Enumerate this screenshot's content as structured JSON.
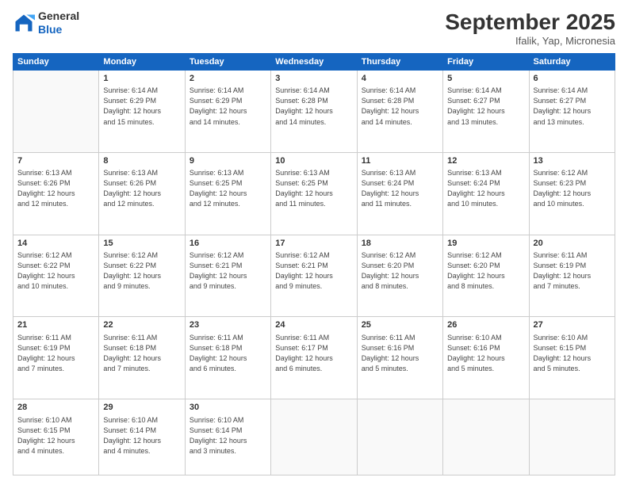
{
  "logo": {
    "general": "General",
    "blue": "Blue"
  },
  "title": "September 2025",
  "location": "Ifalik, Yap, Micronesia",
  "days_header": [
    "Sunday",
    "Monday",
    "Tuesday",
    "Wednesday",
    "Thursday",
    "Friday",
    "Saturday"
  ],
  "weeks": [
    [
      {
        "num": "",
        "info": ""
      },
      {
        "num": "1",
        "info": "Sunrise: 6:14 AM\nSunset: 6:29 PM\nDaylight: 12 hours\nand 15 minutes."
      },
      {
        "num": "2",
        "info": "Sunrise: 6:14 AM\nSunset: 6:29 PM\nDaylight: 12 hours\nand 14 minutes."
      },
      {
        "num": "3",
        "info": "Sunrise: 6:14 AM\nSunset: 6:28 PM\nDaylight: 12 hours\nand 14 minutes."
      },
      {
        "num": "4",
        "info": "Sunrise: 6:14 AM\nSunset: 6:28 PM\nDaylight: 12 hours\nand 14 minutes."
      },
      {
        "num": "5",
        "info": "Sunrise: 6:14 AM\nSunset: 6:27 PM\nDaylight: 12 hours\nand 13 minutes."
      },
      {
        "num": "6",
        "info": "Sunrise: 6:14 AM\nSunset: 6:27 PM\nDaylight: 12 hours\nand 13 minutes."
      }
    ],
    [
      {
        "num": "7",
        "info": "Sunrise: 6:13 AM\nSunset: 6:26 PM\nDaylight: 12 hours\nand 12 minutes."
      },
      {
        "num": "8",
        "info": "Sunrise: 6:13 AM\nSunset: 6:26 PM\nDaylight: 12 hours\nand 12 minutes."
      },
      {
        "num": "9",
        "info": "Sunrise: 6:13 AM\nSunset: 6:25 PM\nDaylight: 12 hours\nand 12 minutes."
      },
      {
        "num": "10",
        "info": "Sunrise: 6:13 AM\nSunset: 6:25 PM\nDaylight: 12 hours\nand 11 minutes."
      },
      {
        "num": "11",
        "info": "Sunrise: 6:13 AM\nSunset: 6:24 PM\nDaylight: 12 hours\nand 11 minutes."
      },
      {
        "num": "12",
        "info": "Sunrise: 6:13 AM\nSunset: 6:24 PM\nDaylight: 12 hours\nand 10 minutes."
      },
      {
        "num": "13",
        "info": "Sunrise: 6:12 AM\nSunset: 6:23 PM\nDaylight: 12 hours\nand 10 minutes."
      }
    ],
    [
      {
        "num": "14",
        "info": "Sunrise: 6:12 AM\nSunset: 6:22 PM\nDaylight: 12 hours\nand 10 minutes."
      },
      {
        "num": "15",
        "info": "Sunrise: 6:12 AM\nSunset: 6:22 PM\nDaylight: 12 hours\nand 9 minutes."
      },
      {
        "num": "16",
        "info": "Sunrise: 6:12 AM\nSunset: 6:21 PM\nDaylight: 12 hours\nand 9 minutes."
      },
      {
        "num": "17",
        "info": "Sunrise: 6:12 AM\nSunset: 6:21 PM\nDaylight: 12 hours\nand 9 minutes."
      },
      {
        "num": "18",
        "info": "Sunrise: 6:12 AM\nSunset: 6:20 PM\nDaylight: 12 hours\nand 8 minutes."
      },
      {
        "num": "19",
        "info": "Sunrise: 6:12 AM\nSunset: 6:20 PM\nDaylight: 12 hours\nand 8 minutes."
      },
      {
        "num": "20",
        "info": "Sunrise: 6:11 AM\nSunset: 6:19 PM\nDaylight: 12 hours\nand 7 minutes."
      }
    ],
    [
      {
        "num": "21",
        "info": "Sunrise: 6:11 AM\nSunset: 6:19 PM\nDaylight: 12 hours\nand 7 minutes."
      },
      {
        "num": "22",
        "info": "Sunrise: 6:11 AM\nSunset: 6:18 PM\nDaylight: 12 hours\nand 7 minutes."
      },
      {
        "num": "23",
        "info": "Sunrise: 6:11 AM\nSunset: 6:18 PM\nDaylight: 12 hours\nand 6 minutes."
      },
      {
        "num": "24",
        "info": "Sunrise: 6:11 AM\nSunset: 6:17 PM\nDaylight: 12 hours\nand 6 minutes."
      },
      {
        "num": "25",
        "info": "Sunrise: 6:11 AM\nSunset: 6:16 PM\nDaylight: 12 hours\nand 5 minutes."
      },
      {
        "num": "26",
        "info": "Sunrise: 6:10 AM\nSunset: 6:16 PM\nDaylight: 12 hours\nand 5 minutes."
      },
      {
        "num": "27",
        "info": "Sunrise: 6:10 AM\nSunset: 6:15 PM\nDaylight: 12 hours\nand 5 minutes."
      }
    ],
    [
      {
        "num": "28",
        "info": "Sunrise: 6:10 AM\nSunset: 6:15 PM\nDaylight: 12 hours\nand 4 minutes."
      },
      {
        "num": "29",
        "info": "Sunrise: 6:10 AM\nSunset: 6:14 PM\nDaylight: 12 hours\nand 4 minutes."
      },
      {
        "num": "30",
        "info": "Sunrise: 6:10 AM\nSunset: 6:14 PM\nDaylight: 12 hours\nand 3 minutes."
      },
      {
        "num": "",
        "info": ""
      },
      {
        "num": "",
        "info": ""
      },
      {
        "num": "",
        "info": ""
      },
      {
        "num": "",
        "info": ""
      }
    ]
  ]
}
